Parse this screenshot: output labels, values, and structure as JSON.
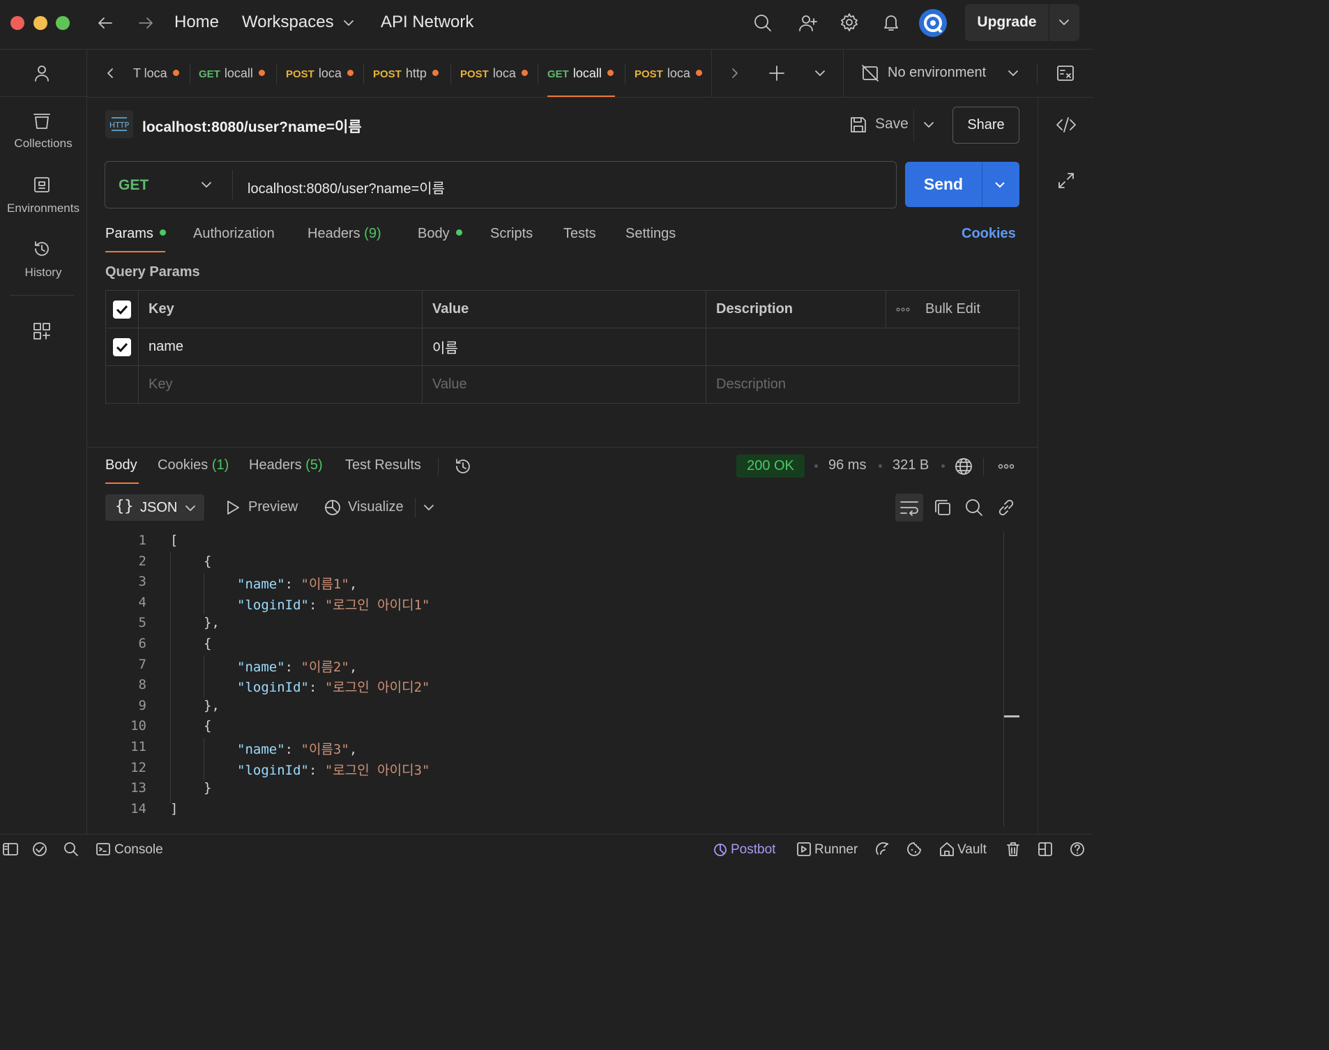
{
  "titlebar": {
    "nav": [
      "Home",
      "Workspaces",
      "API Network"
    ],
    "upgrade_label": "Upgrade"
  },
  "sidebar": {
    "items": [
      {
        "label": "Collections",
        "icon": "collections-icon"
      },
      {
        "label": "Environments",
        "icon": "environments-icon"
      },
      {
        "label": "History",
        "icon": "history-icon"
      }
    ]
  },
  "tabs": [
    {
      "method": "",
      "label": "T loca",
      "method_color": "#f0793a"
    },
    {
      "method": "GET",
      "label": "locall",
      "method_color": "#5fb96c"
    },
    {
      "method": "POST",
      "label": "loca",
      "method_color": "#e8b339"
    },
    {
      "method": "POST",
      "label": "http",
      "method_color": "#e8b339"
    },
    {
      "method": "POST",
      "label": "loca",
      "method_color": "#e8b339"
    },
    {
      "method": "GET",
      "label": "locall",
      "method_color": "#5fb96c"
    },
    {
      "method": "POST",
      "label": "loca",
      "method_color": "#e8b339"
    }
  ],
  "environment": {
    "label": "No environment"
  },
  "request": {
    "title": "localhost:8080/user?name=이름",
    "save_label": "Save",
    "share_label": "Share",
    "method": "GET",
    "url": "localhost:8080/user?name=이름",
    "send_label": "Send"
  },
  "request_tabs": {
    "params": "Params",
    "authorization": "Authorization",
    "headers": "Headers",
    "headers_count": "(9)",
    "body": "Body",
    "scripts": "Scripts",
    "tests": "Tests",
    "settings": "Settings",
    "cookies": "Cookies"
  },
  "query_params": {
    "title": "Query Params",
    "headers": {
      "key": "Key",
      "value": "Value",
      "description": "Description",
      "bulk_edit": "Bulk Edit"
    },
    "rows": [
      {
        "key": "name",
        "value": "이름",
        "description": ""
      }
    ],
    "placeholder": {
      "key": "Key",
      "value": "Value",
      "description": "Description"
    }
  },
  "response": {
    "tabs": {
      "body": "Body",
      "cookies": "Cookies",
      "cookies_count": "(1)",
      "headers": "Headers",
      "headers_count": "(5)",
      "test_results": "Test Results"
    },
    "status": "200 OK",
    "time": "96 ms",
    "size": "321 B",
    "format": "JSON",
    "preview": "Preview",
    "visualize": "Visualize",
    "body_lines": [
      "[",
      "{",
      "\"name\": \"이름1\",",
      "\"loginId\": \"로그인 아이디1\"",
      "},",
      "{",
      "\"name\": \"이름2\",",
      "\"loginId\": \"로그인 아이디2\"",
      "},",
      "{",
      "\"name\": \"이름3\",",
      "\"loginId\": \"로그인 아이디3\"",
      "}",
      "]"
    ]
  },
  "statusbar": {
    "console": "Console",
    "postbot": "Postbot",
    "runner": "Runner",
    "vault": "Vault"
  },
  "colors": {
    "accent": "#f0793a",
    "send": "#2f6fe0",
    "link": "#5e9bf5",
    "success": "#4cc864"
  }
}
